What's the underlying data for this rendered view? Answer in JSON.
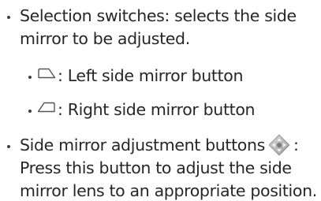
{
  "items": [
    {
      "lines": [
        "Selection switches: selects the side",
        "mirror to be adjusted."
      ]
    },
    {
      "icon": "left-side-mirror-icon",
      "label": ": Left side mirror button"
    },
    {
      "icon": "right-side-mirror-icon",
      "label": ": Right side mirror button"
    },
    {
      "icon": "directional-pad-icon",
      "lines": [
        "Side mirror adjustment buttons",
        ":",
        "Press this button to adjust the side",
        "mirror lens to an appropriate position."
      ]
    }
  ]
}
